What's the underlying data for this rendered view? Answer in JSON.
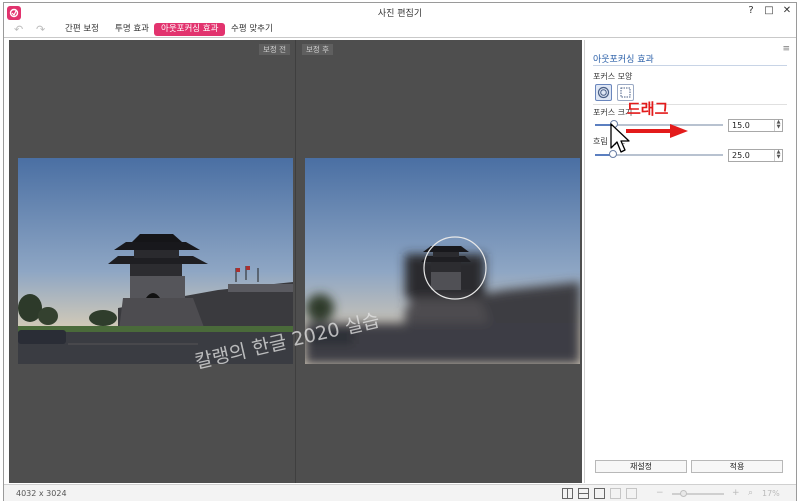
{
  "window": {
    "title": "사진 편집기",
    "controls": [
      "?",
      "□",
      "✕"
    ]
  },
  "tabs": [
    {
      "label": "간편 보정",
      "active": false
    },
    {
      "label": "투명 효과",
      "active": false
    },
    {
      "label": "아웃포커싱 효과",
      "active": true
    },
    {
      "label": "수평 맞추기",
      "active": false
    }
  ],
  "canvas": {
    "before_label": "보정 전",
    "after_label": "보정 후",
    "watermark": "칼랭의 한글 2020 실습"
  },
  "panel": {
    "title": "아웃포커싱 효과",
    "focus_shape_label": "포커스 모양",
    "focus_size_label": "포커스 크기",
    "focus_size_value": "15.0",
    "focus_size_fraction": 0.15,
    "blur_label": "흐림 강도",
    "blur_value": "25.0",
    "blur_fraction": 0.14,
    "reset_button": "재설정",
    "apply_button": "적용"
  },
  "annotation": {
    "text": "드래그"
  },
  "status": {
    "dimensions": "4032 x 3024",
    "zoom": "17%"
  },
  "colors": {
    "accent": "#e2336e",
    "annotation": "#e31b1b",
    "panel_title": "#2a5fa8"
  }
}
